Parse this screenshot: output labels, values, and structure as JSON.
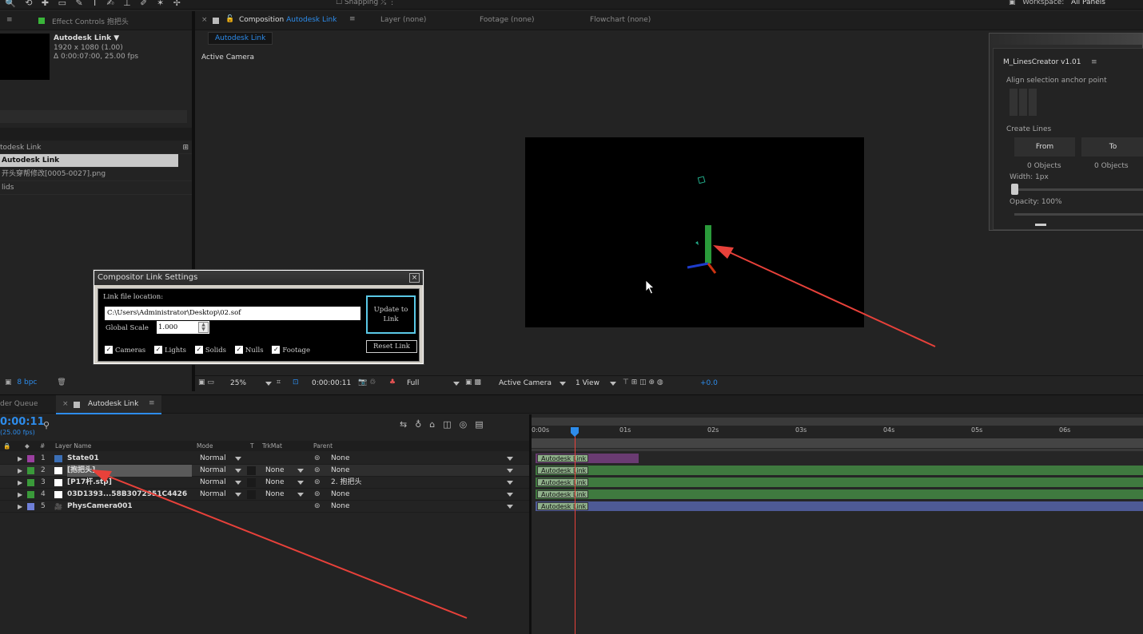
{
  "topbar": {
    "tools": "🔍 ⟲ ✚ ▭ ✎ T ✍ ⊥ ✐ ✶ ✢",
    "snapping": "Snapping",
    "workspace_label": "Workspace:",
    "workspace_value": "All Panels"
  },
  "effect_controls": {
    "tab_label": "Effect Controls 抱把头",
    "comp_name": "Autodesk Link ▼",
    "resolution": "1920 x 1080 (1.00)",
    "duration": "Δ 0:00:07:00, 25.00 fps"
  },
  "project": {
    "header": "todesk Link",
    "items": [
      "Autodesk Link",
      "开头穿帮修改[0005-0027].png",
      "lids"
    ],
    "bpc": "8 bpc"
  },
  "comp_tabs": {
    "comp_prefix": "Composition",
    "comp_name": "Autodesk Link",
    "layer": "Layer (none)",
    "footage": "Footage (none)",
    "flowchart": "Flowchart (none)",
    "breadcrumb": "Autodesk Link",
    "active_camera": "Active Camera"
  },
  "dialog": {
    "title": "Compositor Link Settings",
    "close": "×",
    "link_label": "Link file location:",
    "path": "C:\\Users\\Administrator\\Desktop\\02.sof",
    "scale_label": "Global Scale",
    "scale_value": "1.000",
    "update_btn": "Update to Link",
    "reset_btn": "Reset Link",
    "checks": [
      "Cameras",
      "Lights",
      "Solids",
      "Nulls",
      "Footage"
    ]
  },
  "lines_creator": {
    "title": "M_LinesCreator v1.01",
    "align": "Align selection anchor point",
    "create": "Create Lines",
    "from": "From",
    "to": "To",
    "from_count": "0 Objects",
    "to_count": "0 Objects",
    "width": "Width: 1px",
    "opacity": "Opacity: 100%"
  },
  "viewer_bar": {
    "zoom": "25%",
    "timecode": "0:00:00:11",
    "resolution": "Full",
    "camera": "Active Camera",
    "views": "1 View",
    "exposure": "+0.0"
  },
  "timeline": {
    "render_queue": "der Queue",
    "tab": "Autodesk Link",
    "timecode": "0:00:11",
    "fps": "(25.00 fps)",
    "col_layer": "Layer Name",
    "col_mode": "Mode",
    "col_t": "T",
    "col_trkmat": "TrkMat",
    "col_parent": "Parent",
    "ruler": [
      "0:00s",
      "01s",
      "02s",
      "03s",
      "04s",
      "05s",
      "06s"
    ],
    "layers": [
      {
        "num": "1",
        "name": "State01",
        "color": "#9b3fa0",
        "mode": "Normal",
        "trkmat": "",
        "parent": "None",
        "bar_color": "#6a3b72",
        "bar_end": 0.17
      },
      {
        "num": "2",
        "name": "[抱把头]",
        "color": "#3a9a3a",
        "mode": "Normal",
        "trkmat": "None",
        "parent": "None",
        "bar_color": "#3f7a3f",
        "bar_end": 1.0
      },
      {
        "num": "3",
        "name": "[P17杆.stp]",
        "color": "#3a9a3a",
        "mode": "Normal",
        "trkmat": "None",
        "parent": "2. 抱把头",
        "bar_color": "#3f7a3f",
        "bar_end": 1.0
      },
      {
        "num": "4",
        "name": "03D1393...58B3072951C4426",
        "color": "#3a9a3a",
        "mode": "Normal",
        "trkmat": "None",
        "parent": "None",
        "bar_color": "#3f7a3f",
        "bar_end": 1.0
      },
      {
        "num": "5",
        "name": "PhysCamera001",
        "color": "#6f7fd8",
        "mode": "",
        "trkmat": "",
        "parent": "None",
        "bar_color": "#4e5a96",
        "bar_end": 1.0
      }
    ],
    "bar_label": "Autodesk Link"
  },
  "colors": {
    "accent": "#2d8ceb",
    "arrow": "#e8413a"
  }
}
